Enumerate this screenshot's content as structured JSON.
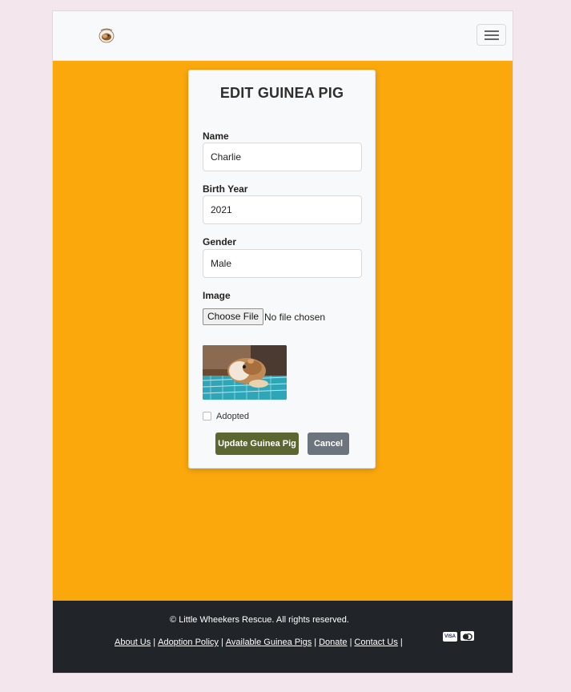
{
  "navbar": {
    "logo_icon": "guinea-pig-logo-icon",
    "toggler_icon": "hamburger-menu-icon"
  },
  "form": {
    "title": "EDIT GUINEA PIG",
    "name_label": "Name",
    "name_value": "Charlie",
    "birth_year_label": "Birth Year",
    "birth_year_value": "2021",
    "gender_label": "Gender",
    "gender_value": "Male",
    "image_label": "Image",
    "file_button_label": "Choose File",
    "file_status": "No file chosen",
    "adopted_label": "Adopted",
    "update_button": "Update Guinea Pig",
    "cancel_button": "Cancel"
  },
  "footer": {
    "copyright": "© Little Wheekers Rescue. All rights reserved.",
    "links": [
      "About Us",
      "Adoption Policy",
      "Available Guinea Pigs",
      "Donate",
      "Contact Us"
    ],
    "visa_text": "VISA",
    "payment_icons": [
      "visa-icon",
      "mastercard-icon"
    ]
  },
  "colors": {
    "page_background": "#fba80d",
    "update_button": "#5c6630",
    "cancel_button": "#6c757d",
    "footer": "#212529"
  }
}
